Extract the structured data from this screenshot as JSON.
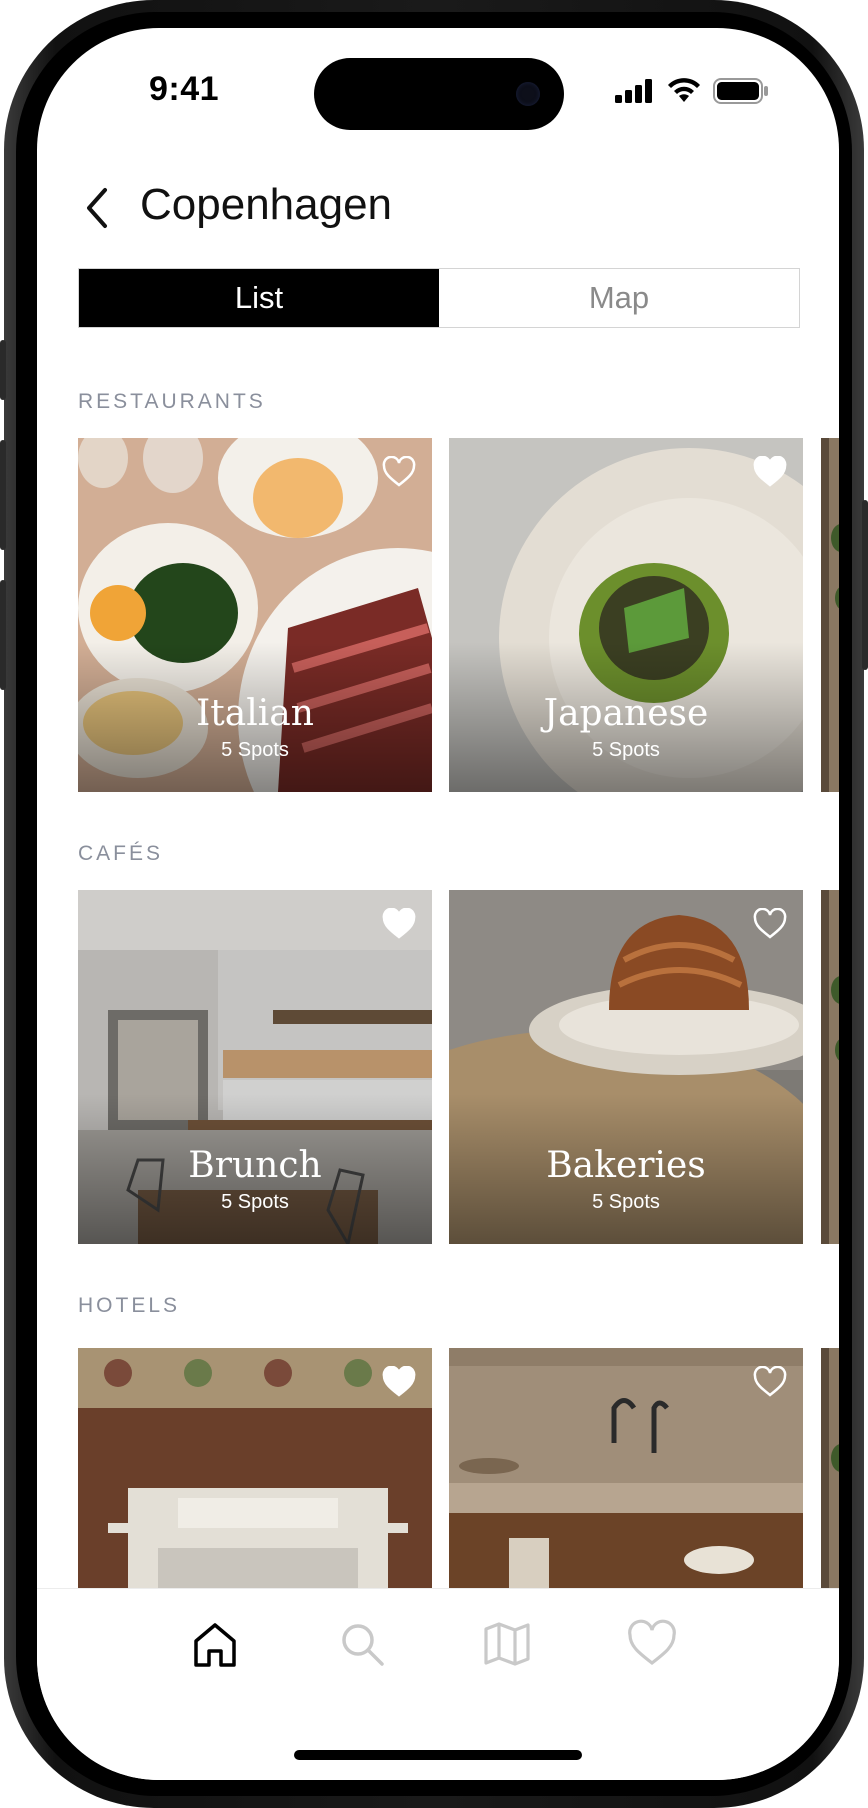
{
  "status_bar": {
    "time": "9:41"
  },
  "header": {
    "title": "Copenhagen"
  },
  "view_toggle": {
    "options": [
      "List",
      "Map"
    ],
    "selected": "List"
  },
  "sections": [
    {
      "label": "RESTAURANTS",
      "cards": [
        {
          "title": "Italian",
          "subtitle": "5 Spots",
          "favorited": false
        },
        {
          "title": "Japanese",
          "subtitle": "5 Spots",
          "favorited": true
        }
      ]
    },
    {
      "label": "CAFÉS",
      "cards": [
        {
          "title": "Brunch",
          "subtitle": "5 Spots",
          "favorited": true
        },
        {
          "title": "Bakeries",
          "subtitle": "5 Spots",
          "favorited": false
        }
      ]
    },
    {
      "label": "HOTELS",
      "cards": [
        {
          "title": "",
          "subtitle": "",
          "favorited": true
        },
        {
          "title": "",
          "subtitle": "",
          "favorited": false
        }
      ]
    }
  ],
  "tab_bar": {
    "items": [
      "home-icon",
      "search-icon",
      "map-icon",
      "heart-icon"
    ],
    "active": "home-icon"
  },
  "colors": {
    "accent": "#000000",
    "section_label": "#8a8f9c",
    "inactive_icon": "#c9c9c9"
  }
}
